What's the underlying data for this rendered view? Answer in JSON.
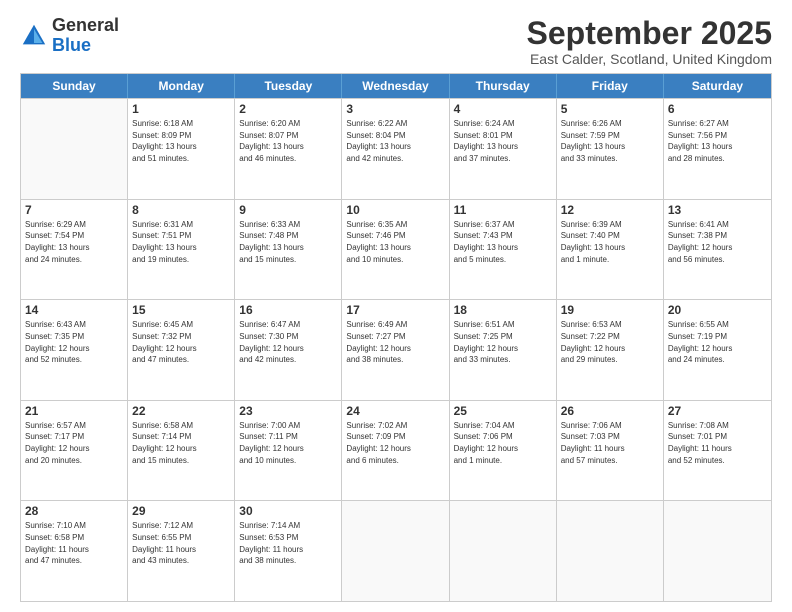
{
  "logo": {
    "general": "General",
    "blue": "Blue"
  },
  "title": "September 2025",
  "subtitle": "East Calder, Scotland, United Kingdom",
  "headers": [
    "Sunday",
    "Monday",
    "Tuesday",
    "Wednesday",
    "Thursday",
    "Friday",
    "Saturday"
  ],
  "weeks": [
    [
      {
        "day": "",
        "info": ""
      },
      {
        "day": "1",
        "info": "Sunrise: 6:18 AM\nSunset: 8:09 PM\nDaylight: 13 hours\nand 51 minutes."
      },
      {
        "day": "2",
        "info": "Sunrise: 6:20 AM\nSunset: 8:07 PM\nDaylight: 13 hours\nand 46 minutes."
      },
      {
        "day": "3",
        "info": "Sunrise: 6:22 AM\nSunset: 8:04 PM\nDaylight: 13 hours\nand 42 minutes."
      },
      {
        "day": "4",
        "info": "Sunrise: 6:24 AM\nSunset: 8:01 PM\nDaylight: 13 hours\nand 37 minutes."
      },
      {
        "day": "5",
        "info": "Sunrise: 6:26 AM\nSunset: 7:59 PM\nDaylight: 13 hours\nand 33 minutes."
      },
      {
        "day": "6",
        "info": "Sunrise: 6:27 AM\nSunset: 7:56 PM\nDaylight: 13 hours\nand 28 minutes."
      }
    ],
    [
      {
        "day": "7",
        "info": "Sunrise: 6:29 AM\nSunset: 7:54 PM\nDaylight: 13 hours\nand 24 minutes."
      },
      {
        "day": "8",
        "info": "Sunrise: 6:31 AM\nSunset: 7:51 PM\nDaylight: 13 hours\nand 19 minutes."
      },
      {
        "day": "9",
        "info": "Sunrise: 6:33 AM\nSunset: 7:48 PM\nDaylight: 13 hours\nand 15 minutes."
      },
      {
        "day": "10",
        "info": "Sunrise: 6:35 AM\nSunset: 7:46 PM\nDaylight: 13 hours\nand 10 minutes."
      },
      {
        "day": "11",
        "info": "Sunrise: 6:37 AM\nSunset: 7:43 PM\nDaylight: 13 hours\nand 5 minutes."
      },
      {
        "day": "12",
        "info": "Sunrise: 6:39 AM\nSunset: 7:40 PM\nDaylight: 13 hours\nand 1 minute."
      },
      {
        "day": "13",
        "info": "Sunrise: 6:41 AM\nSunset: 7:38 PM\nDaylight: 12 hours\nand 56 minutes."
      }
    ],
    [
      {
        "day": "14",
        "info": "Sunrise: 6:43 AM\nSunset: 7:35 PM\nDaylight: 12 hours\nand 52 minutes."
      },
      {
        "day": "15",
        "info": "Sunrise: 6:45 AM\nSunset: 7:32 PM\nDaylight: 12 hours\nand 47 minutes."
      },
      {
        "day": "16",
        "info": "Sunrise: 6:47 AM\nSunset: 7:30 PM\nDaylight: 12 hours\nand 42 minutes."
      },
      {
        "day": "17",
        "info": "Sunrise: 6:49 AM\nSunset: 7:27 PM\nDaylight: 12 hours\nand 38 minutes."
      },
      {
        "day": "18",
        "info": "Sunrise: 6:51 AM\nSunset: 7:25 PM\nDaylight: 12 hours\nand 33 minutes."
      },
      {
        "day": "19",
        "info": "Sunrise: 6:53 AM\nSunset: 7:22 PM\nDaylight: 12 hours\nand 29 minutes."
      },
      {
        "day": "20",
        "info": "Sunrise: 6:55 AM\nSunset: 7:19 PM\nDaylight: 12 hours\nand 24 minutes."
      }
    ],
    [
      {
        "day": "21",
        "info": "Sunrise: 6:57 AM\nSunset: 7:17 PM\nDaylight: 12 hours\nand 20 minutes."
      },
      {
        "day": "22",
        "info": "Sunrise: 6:58 AM\nSunset: 7:14 PM\nDaylight: 12 hours\nand 15 minutes."
      },
      {
        "day": "23",
        "info": "Sunrise: 7:00 AM\nSunset: 7:11 PM\nDaylight: 12 hours\nand 10 minutes."
      },
      {
        "day": "24",
        "info": "Sunrise: 7:02 AM\nSunset: 7:09 PM\nDaylight: 12 hours\nand 6 minutes."
      },
      {
        "day": "25",
        "info": "Sunrise: 7:04 AM\nSunset: 7:06 PM\nDaylight: 12 hours\nand 1 minute."
      },
      {
        "day": "26",
        "info": "Sunrise: 7:06 AM\nSunset: 7:03 PM\nDaylight: 11 hours\nand 57 minutes."
      },
      {
        "day": "27",
        "info": "Sunrise: 7:08 AM\nSunset: 7:01 PM\nDaylight: 11 hours\nand 52 minutes."
      }
    ],
    [
      {
        "day": "28",
        "info": "Sunrise: 7:10 AM\nSunset: 6:58 PM\nDaylight: 11 hours\nand 47 minutes."
      },
      {
        "day": "29",
        "info": "Sunrise: 7:12 AM\nSunset: 6:55 PM\nDaylight: 11 hours\nand 43 minutes."
      },
      {
        "day": "30",
        "info": "Sunrise: 7:14 AM\nSunset: 6:53 PM\nDaylight: 11 hours\nand 38 minutes."
      },
      {
        "day": "",
        "info": ""
      },
      {
        "day": "",
        "info": ""
      },
      {
        "day": "",
        "info": ""
      },
      {
        "day": "",
        "info": ""
      }
    ]
  ]
}
